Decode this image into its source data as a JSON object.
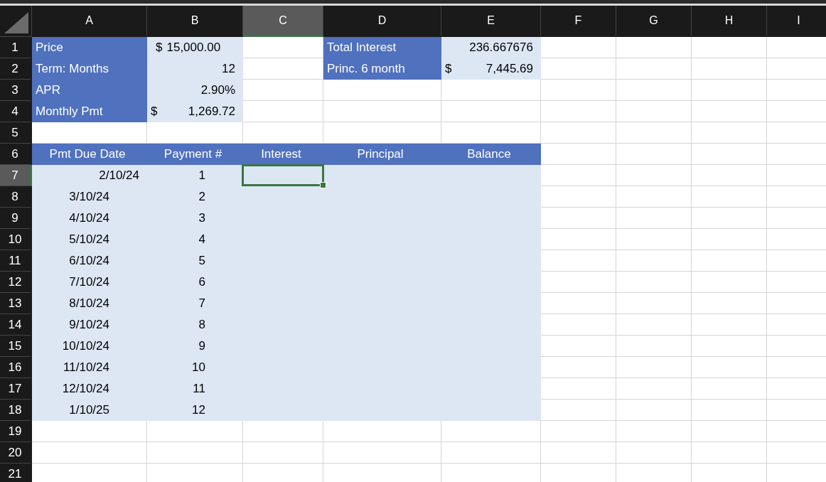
{
  "columns": [
    {
      "label": "A",
      "selected": false
    },
    {
      "label": "B",
      "selected": false
    },
    {
      "label": "C",
      "selected": true
    },
    {
      "label": "D",
      "selected": false
    },
    {
      "label": "E",
      "selected": false
    },
    {
      "label": "F",
      "selected": false
    },
    {
      "label": "G",
      "selected": false
    },
    {
      "label": "H",
      "selected": false
    },
    {
      "label": "I",
      "selected": false
    }
  ],
  "rows": [
    {
      "number": "1",
      "selected": false,
      "cells": [
        {
          "kind": "label",
          "text": "Price"
        },
        {
          "kind": "value",
          "symbol": "$",
          "text": "15,000.00",
          "tight": true
        },
        {
          "kind": "blank"
        },
        {
          "kind": "label",
          "text": "Total Interest"
        },
        {
          "kind": "value",
          "text": "236.667676"
        }
      ]
    },
    {
      "number": "2",
      "selected": false,
      "cells": [
        {
          "kind": "label",
          "text": "Term: Months"
        },
        {
          "kind": "value",
          "text": "12"
        },
        {
          "kind": "blank"
        },
        {
          "kind": "label",
          "text": "Princ. 6 month"
        },
        {
          "kind": "value",
          "symbol": "$",
          "text": "7,445.69"
        }
      ]
    },
    {
      "number": "3",
      "selected": false,
      "cells": [
        {
          "kind": "label",
          "text": "APR"
        },
        {
          "kind": "value",
          "text": "2.90%"
        }
      ]
    },
    {
      "number": "4",
      "selected": false,
      "cells": [
        {
          "kind": "label",
          "text": "Monthly Pmt"
        },
        {
          "kind": "value",
          "symbol": "$",
          "text": "1,269.72"
        }
      ]
    },
    {
      "number": "5",
      "selected": false
    },
    {
      "number": "6",
      "selected": false,
      "cells": [
        {
          "kind": "header",
          "text": "Pmt Due Date"
        },
        {
          "kind": "header",
          "text": "Payment #"
        },
        {
          "kind": "header",
          "text": "Interest"
        },
        {
          "kind": "header",
          "text": "Principal"
        },
        {
          "kind": "header",
          "text": "Balance"
        }
      ]
    },
    {
      "number": "7",
      "selected": true,
      "cells": [
        {
          "kind": "band",
          "text": "2/10/24"
        },
        {
          "kind": "band",
          "text": "1",
          "inset": true
        },
        {
          "kind": "band"
        },
        {
          "kind": "band"
        },
        {
          "kind": "band"
        }
      ]
    },
    {
      "number": "8",
      "selected": false,
      "cells": [
        {
          "kind": "band",
          "text": "3/10/24",
          "inset": true
        },
        {
          "kind": "band",
          "text": "2",
          "inset": true
        },
        {
          "kind": "band"
        },
        {
          "kind": "band"
        },
        {
          "kind": "band"
        }
      ]
    },
    {
      "number": "9",
      "selected": false,
      "cells": [
        {
          "kind": "band",
          "text": "4/10/24",
          "inset": true
        },
        {
          "kind": "band",
          "text": "3",
          "inset": true
        },
        {
          "kind": "band"
        },
        {
          "kind": "band"
        },
        {
          "kind": "band"
        }
      ]
    },
    {
      "number": "10",
      "selected": false,
      "cells": [
        {
          "kind": "band",
          "text": "5/10/24",
          "inset": true
        },
        {
          "kind": "band",
          "text": "4",
          "inset": true
        },
        {
          "kind": "band"
        },
        {
          "kind": "band"
        },
        {
          "kind": "band"
        }
      ]
    },
    {
      "number": "11",
      "selected": false,
      "cells": [
        {
          "kind": "band",
          "text": "6/10/24",
          "inset": true
        },
        {
          "kind": "band",
          "text": "5",
          "inset": true
        },
        {
          "kind": "band"
        },
        {
          "kind": "band"
        },
        {
          "kind": "band"
        }
      ]
    },
    {
      "number": "12",
      "selected": false,
      "cells": [
        {
          "kind": "band",
          "text": "7/10/24",
          "inset": true
        },
        {
          "kind": "band",
          "text": "6",
          "inset": true
        },
        {
          "kind": "band"
        },
        {
          "kind": "band"
        },
        {
          "kind": "band"
        }
      ]
    },
    {
      "number": "13",
      "selected": false,
      "cells": [
        {
          "kind": "band",
          "text": "8/10/24",
          "inset": true
        },
        {
          "kind": "band",
          "text": "7",
          "inset": true
        },
        {
          "kind": "band"
        },
        {
          "kind": "band"
        },
        {
          "kind": "band"
        }
      ]
    },
    {
      "number": "14",
      "selected": false,
      "cells": [
        {
          "kind": "band",
          "text": "9/10/24",
          "inset": true
        },
        {
          "kind": "band",
          "text": "8",
          "inset": true
        },
        {
          "kind": "band"
        },
        {
          "kind": "band"
        },
        {
          "kind": "band"
        }
      ]
    },
    {
      "number": "15",
      "selected": false,
      "cells": [
        {
          "kind": "band",
          "text": "10/10/24",
          "inset": true
        },
        {
          "kind": "band",
          "text": "9",
          "inset": true
        },
        {
          "kind": "band"
        },
        {
          "kind": "band"
        },
        {
          "kind": "band"
        }
      ]
    },
    {
      "number": "16",
      "selected": false,
      "cells": [
        {
          "kind": "band",
          "text": "11/10/24",
          "inset": true
        },
        {
          "kind": "band",
          "text": "10",
          "inset": true
        },
        {
          "kind": "band"
        },
        {
          "kind": "band"
        },
        {
          "kind": "band"
        }
      ]
    },
    {
      "number": "17",
      "selected": false,
      "cells": [
        {
          "kind": "band",
          "text": "12/10/24",
          "inset": true
        },
        {
          "kind": "band",
          "text": "11",
          "inset": true
        },
        {
          "kind": "band"
        },
        {
          "kind": "band"
        },
        {
          "kind": "band"
        }
      ]
    },
    {
      "number": "18",
      "selected": false,
      "cells": [
        {
          "kind": "band",
          "text": "1/10/25",
          "inset": true
        },
        {
          "kind": "band",
          "text": "12",
          "inset": true
        },
        {
          "kind": "band"
        },
        {
          "kind": "band"
        },
        {
          "kind": "band"
        }
      ]
    },
    {
      "number": "19",
      "selected": false
    },
    {
      "number": "20",
      "selected": false
    },
    {
      "number": "21",
      "selected": false
    }
  ]
}
